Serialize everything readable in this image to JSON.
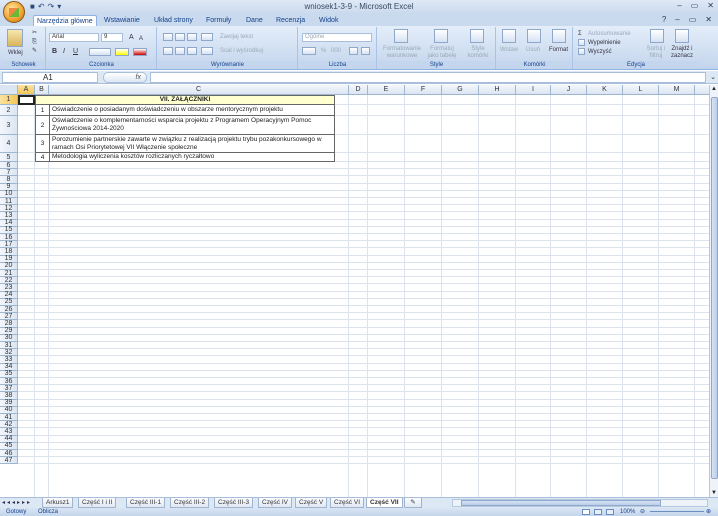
{
  "window": {
    "title": "wniosek1-3-9 - Microsoft Excel",
    "controls": [
      "–",
      "▭",
      "✕"
    ]
  },
  "ribbon_tabs": [
    "Narzędzia główne",
    "Wstawianie",
    "Układ strony",
    "Formuły",
    "Dane",
    "Recenzja",
    "Widok"
  ],
  "ribbon_right_controls": [
    "?",
    "–",
    "▭",
    "✕"
  ],
  "ribbon": {
    "schowek": {
      "label": "Schowek",
      "paste": "Wklej"
    },
    "czcionka": {
      "label": "Czcionka",
      "font_name": "Arial",
      "font_size": "9",
      "bold": "B",
      "italic": "I",
      "underline": "U",
      "grow": "A",
      "shrink": "A"
    },
    "wyrownanie": {
      "label": "Wyrównanie",
      "wrap": "Zawijaj tekst",
      "merge": "Scal i wyśrodkuj"
    },
    "liczba": {
      "label": "Liczba",
      "format": "Ogólne",
      "percent": "%",
      "thousands": "000"
    },
    "style": {
      "label": "Style",
      "conditional": "Formatowanie warunkowe",
      "as_table": "Formatuj jako tabelę",
      "cell_styles": "Style komórki"
    },
    "komorki": {
      "label": "Komórki",
      "insert": "Wstaw",
      "delete": "Usuń",
      "format": "Format"
    },
    "edycja": {
      "label": "Edycja",
      "autosum": "Autosumowanie",
      "fill": "Wypełnienie",
      "clear": "Wyczyść",
      "sort": "Sortuj i filtruj",
      "find": "Znajdź i zaznacz"
    }
  },
  "formula_bar": {
    "name_box": "A1",
    "fx": "fx",
    "formula": ""
  },
  "columns": [
    "A",
    "B",
    "C",
    "D",
    "E",
    "F",
    "G",
    "H",
    "I",
    "J",
    "K",
    "L",
    "M",
    "N"
  ],
  "rows": [
    "1",
    "2",
    "3",
    "4",
    "5",
    "6",
    "7",
    "8",
    "9",
    "10",
    "11",
    "12",
    "13",
    "14",
    "15",
    "16",
    "17",
    "18",
    "19",
    "20",
    "21",
    "22",
    "23",
    "24",
    "25",
    "26",
    "27",
    "28",
    "29",
    "30",
    "31",
    "32",
    "33",
    "34",
    "35",
    "36",
    "37",
    "38",
    "39",
    "40",
    "41",
    "42",
    "43",
    "44",
    "45",
    "46",
    "47"
  ],
  "sheet": {
    "header": "VII. ZAŁĄCZNIKI",
    "items": [
      {
        "num": "1",
        "text": "Oświadczenie o posiadanym doświadczeniu w obszarze mentorycznym projektu"
      },
      {
        "num": "2",
        "text": "Oświadczenie o komplementarności wsparcia projektu z Programem Operacyjnym Pomoc Żywnościowa 2014-2020"
      },
      {
        "num": "3",
        "text": "Porozumienie partnerskie zawarte w związku z realizacją projektu trybu pozakonkursowego w ramach Osi Priorytetowej VII Włączenie społeczne"
      },
      {
        "num": "4",
        "text": "Metodologia wyliczenia kosztów rozliczanych ryczałtowo"
      }
    ]
  },
  "sheet_tabs": [
    "Arkusz1",
    "Część I i II",
    "Część III-1",
    "Część III-2",
    "Część III-3",
    "Część IV",
    "Część V",
    "Część VI",
    "Część VII"
  ],
  "active_sheet_tab": "Część VII",
  "status": {
    "ready": "Gotowy",
    "calc": "Oblicza",
    "zoom": "100%"
  }
}
